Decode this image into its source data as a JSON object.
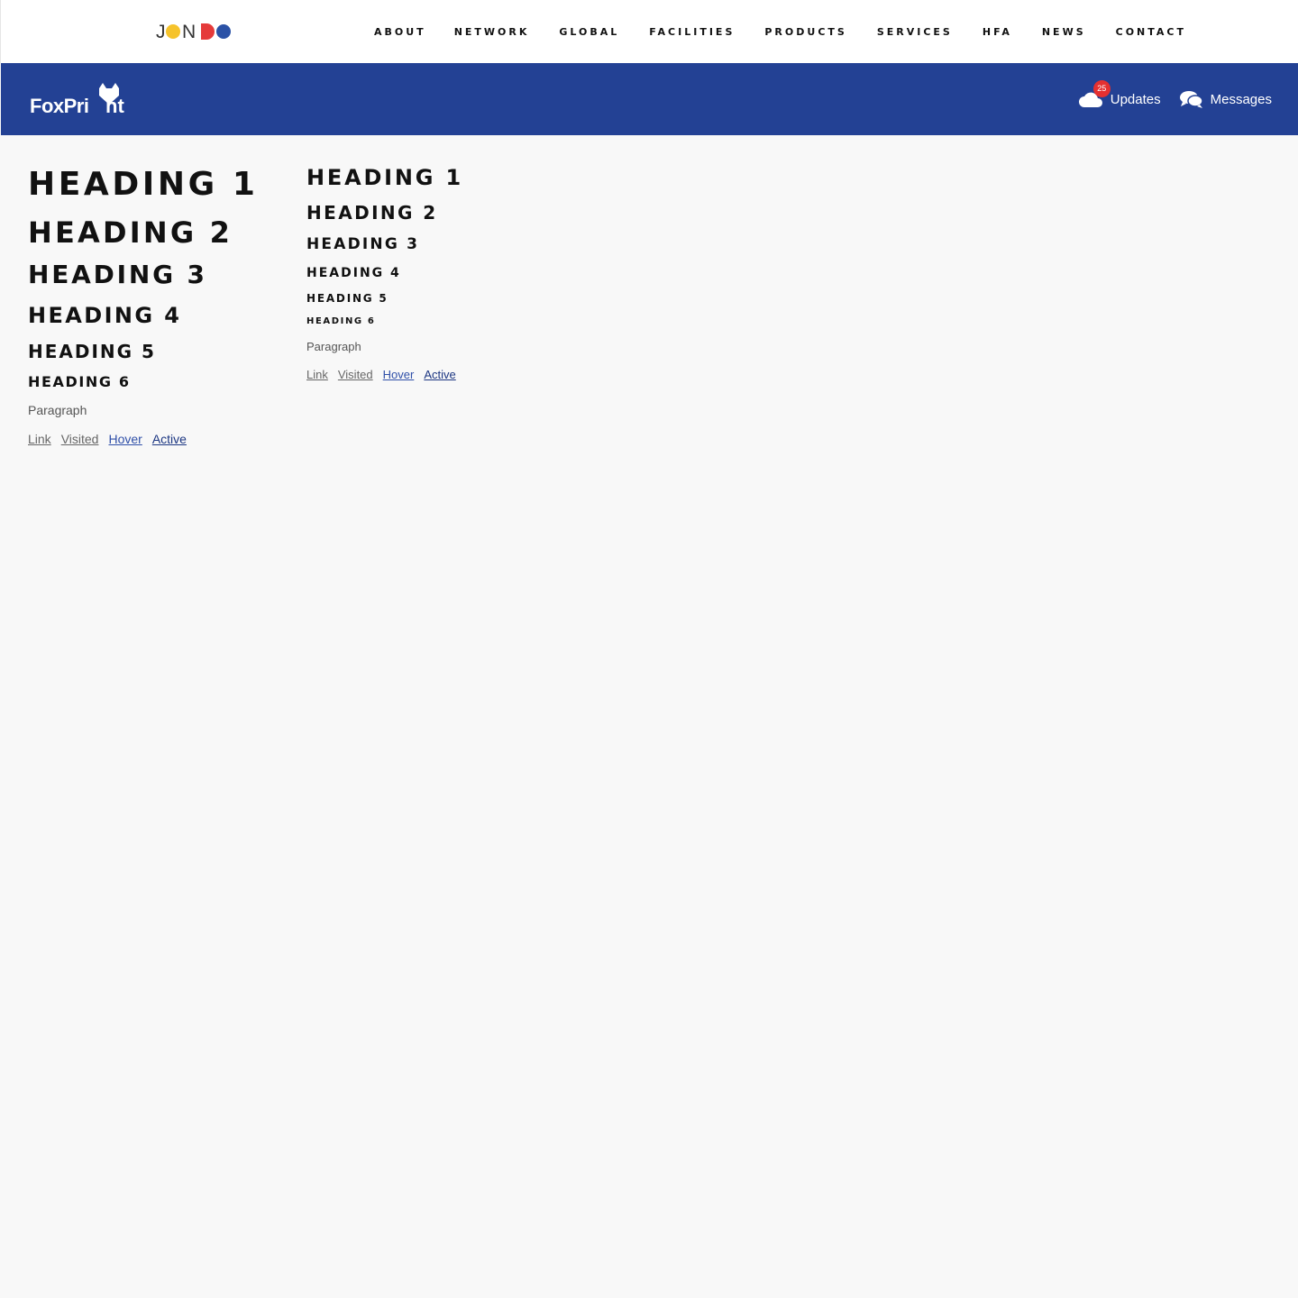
{
  "topnav": {
    "brand": "JONDO",
    "menu": [
      "ABOUT",
      "NETWORK",
      "GLOBAL",
      "FACILITIES",
      "PRODUCTS",
      "SERVICES",
      "HFA",
      "NEWS",
      "CONTACT"
    ]
  },
  "header": {
    "logo_text": "FoxPrint",
    "updates_label": "Updates",
    "updates_count": "25",
    "messages_label": "Messages",
    "background": "#234194",
    "badge_color": "#e53030"
  },
  "left_samples": {
    "h1": "HEADING 1",
    "h2": "HEADING 2",
    "h3": "HEADING 3",
    "h4": "HEADING 4",
    "h5": "HEADING 5",
    "h6": "HEADING 6",
    "paragraph": "Paragraph",
    "links": {
      "link": "Link",
      "visited": "Visited",
      "hover": "Hover",
      "active": "Active"
    }
  },
  "right_samples": {
    "h1": "HEADING 1",
    "h2": "HEADING 2",
    "h3": "HEADING 3",
    "h4": "HEADING 4",
    "h5": "HEADING 5",
    "h6": "HEADING 6",
    "paragraph": "Paragraph",
    "links": {
      "link": "Link",
      "visited": "Visited",
      "hover": "Hover",
      "active": "Active"
    }
  }
}
